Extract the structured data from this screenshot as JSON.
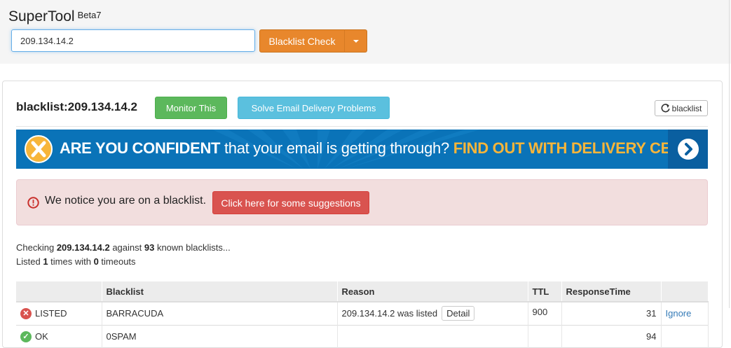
{
  "app": {
    "name": "SuperTool",
    "version": "Beta7"
  },
  "search": {
    "value": "209.134.14.2",
    "button_label": "Blacklist Check"
  },
  "result": {
    "heading": "blacklist:209.134.14.2",
    "monitor_label": "Monitor This",
    "solve_label": "Solve Email Delivery Problems",
    "refresh_label": "blacklist"
  },
  "banner": {
    "part1": "ARE YOU CONFIDENT",
    "part2": " that your email is getting through? ",
    "part3": "FIND OUT WITH DELIVERY CENTER"
  },
  "alert": {
    "message": "We notice you are on a blacklist.",
    "button_label": "Click here for some suggestions"
  },
  "summary": {
    "checking_prefix": "Checking ",
    "ip": "209.134.14.2",
    "against": " against ",
    "count": "93",
    "known": " known blacklists...",
    "listed_prefix": "Listed ",
    "listed_count": "1",
    "times_with": " times with ",
    "timeouts_count": "0",
    "timeouts": " timeouts"
  },
  "table": {
    "headers": [
      "",
      "Blacklist",
      "Reason",
      "TTL",
      "ResponseTime",
      ""
    ],
    "rows": [
      {
        "status": "LISTED",
        "blacklist": "BARRACUDA",
        "reason": "209.134.14.2 was listed",
        "detail": "Detail",
        "ttl": "900",
        "response": "31",
        "action": "Ignore"
      },
      {
        "status": "OK",
        "blacklist": "0SPAM",
        "reason": "",
        "detail": "",
        "ttl": "",
        "response": "94",
        "action": ""
      }
    ]
  },
  "colors": {
    "orange": "#e8872c",
    "green": "#5cb85c",
    "info": "#5bc0de",
    "danger": "#d9534f",
    "banner_blue": "#0a73b8",
    "banner_gold": "#f7b53a"
  }
}
